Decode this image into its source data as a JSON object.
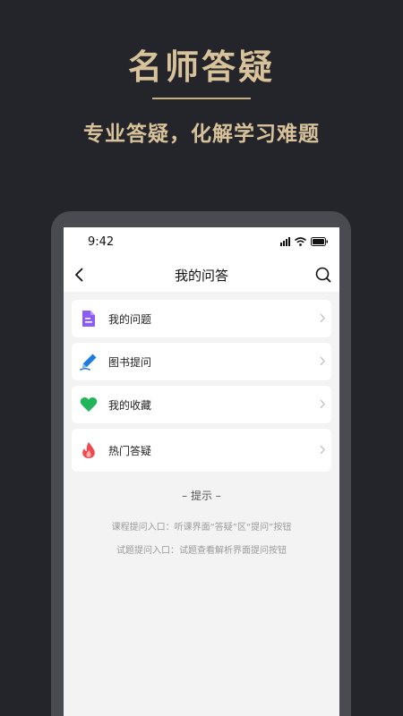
{
  "promo": {
    "title": "名师答疑",
    "subtitle": "专业答疑，化解学习难题"
  },
  "status_bar": {
    "time": "9:42"
  },
  "nav": {
    "title": "我的问答",
    "back_icon": "chevron-left-icon",
    "search_icon": "search-icon"
  },
  "menu": {
    "items": [
      {
        "label": "我的问题",
        "icon": "document-icon",
        "color": "#8b5cf6"
      },
      {
        "label": "图书提问",
        "icon": "pencil-icon",
        "color": "#1e7be0"
      },
      {
        "label": "我的收藏",
        "icon": "heart-icon",
        "color": "#22b45a"
      },
      {
        "label": "热门答疑",
        "icon": "flame-icon",
        "color": "#f0484e"
      }
    ]
  },
  "tips": {
    "title": "– 提示 –",
    "lines": [
      "课程提问入口：听课界面“答疑”区“提问”按钮",
      "试题提问入口：试题查看解析界面提问按钮"
    ]
  },
  "colors": {
    "background": "#24252a",
    "gold": "#d8c29a",
    "phone_frame": "#4a4b50"
  }
}
